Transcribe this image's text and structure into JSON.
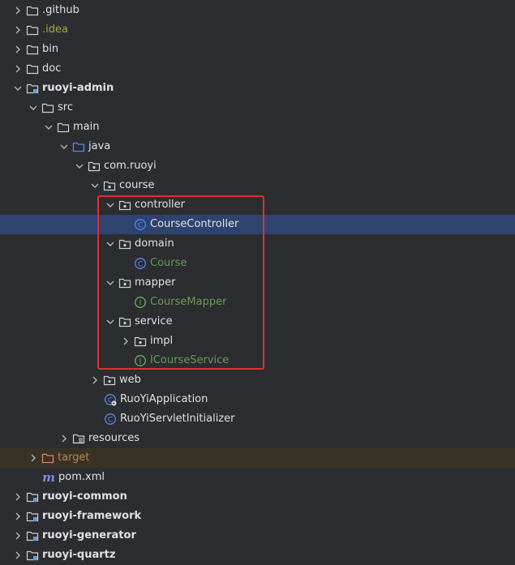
{
  "tree": [
    {
      "label": "github_label",
      "text": ".github"
    },
    {
      "text": ".idea"
    }
  ],
  "items": {
    "github": ".github",
    "idea": ".idea",
    "bin": "bin",
    "doc": "doc",
    "ruoyi_admin": "ruoyi-admin",
    "src": "src",
    "main": "main",
    "java": "java",
    "com_ruoyi": "com.ruoyi",
    "course": "course",
    "controller": "controller",
    "course_controller": "CourseController",
    "domain": "domain",
    "course_class": "Course",
    "mapper": "mapper",
    "course_mapper": "CourseMapper",
    "service": "service",
    "impl": "impl",
    "icourse_service": "ICourseService",
    "web": "web",
    "ruoyi_application": "RuoYiApplication",
    "ruoyi_servlet": "RuoYiServletInitializer",
    "resources": "resources",
    "target": "target",
    "pom": "pom.xml",
    "ruoyi_common": "ruoyi-common",
    "ruoyi_framework": "ruoyi-framework",
    "ruoyi_generator": "ruoyi-generator",
    "ruoyi_quartz": "ruoyi-quartz"
  },
  "icons": {
    "folder": "folder-icon",
    "package": "package-icon",
    "module": "module-folder-icon",
    "source_root": "source-root-icon",
    "resources_root": "resources-root-icon",
    "excluded": "excluded-folder-icon",
    "class": "class-icon",
    "interface": "interface-icon",
    "spring_app": "spring-app-class-icon",
    "maven": "maven-icon"
  },
  "colors": {
    "background": "#2b2d30",
    "selection": "#2e436e",
    "excluded_row": "#3a3226",
    "highlight_border": "#e32f2f",
    "class_icon": "#548af7",
    "interface_icon": "#5fb865",
    "green_text": "#6a9955",
    "idea_text": "#a9a946",
    "target_text": "#b28b4e"
  }
}
